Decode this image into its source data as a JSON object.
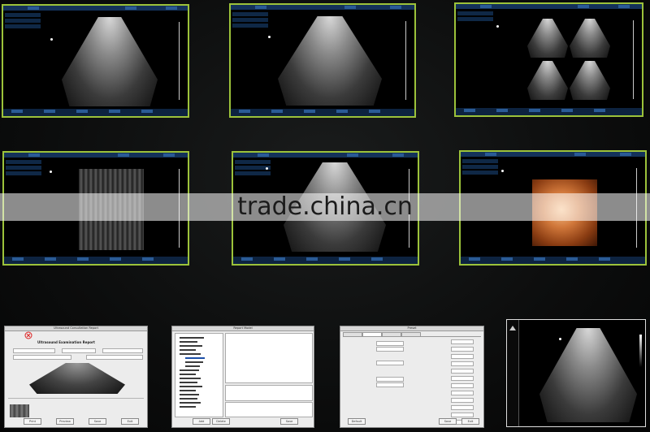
{
  "watermark": "trade.china.cn",
  "colors": {
    "tile_border": "#9cc23a",
    "toolbar": "#14325a",
    "background": "#0c0d0d"
  },
  "tiles": [
    {
      "id": "abdomen-scan"
    },
    {
      "id": "convex-scan"
    },
    {
      "id": "quad-view"
    },
    {
      "id": "linear-scan"
    },
    {
      "id": "fetal-head-scan"
    },
    {
      "id": "3d-render"
    }
  ],
  "windows": [
    {
      "id": "ultrasound-report",
      "title": "Ultrasound Consultation Report",
      "buttons": [
        "Print",
        "Preview",
        "Save",
        "Exit"
      ],
      "heading": "Ultrasound Examination Report"
    },
    {
      "id": "report-editor",
      "title": "Report Model",
      "buttons": [
        "Add",
        "Delete",
        "Save"
      ]
    },
    {
      "id": "preset-settings",
      "title": "Preset",
      "buttons": [
        "Default",
        "Save",
        "Exit"
      ]
    },
    {
      "id": "kidney-scan"
    }
  ]
}
